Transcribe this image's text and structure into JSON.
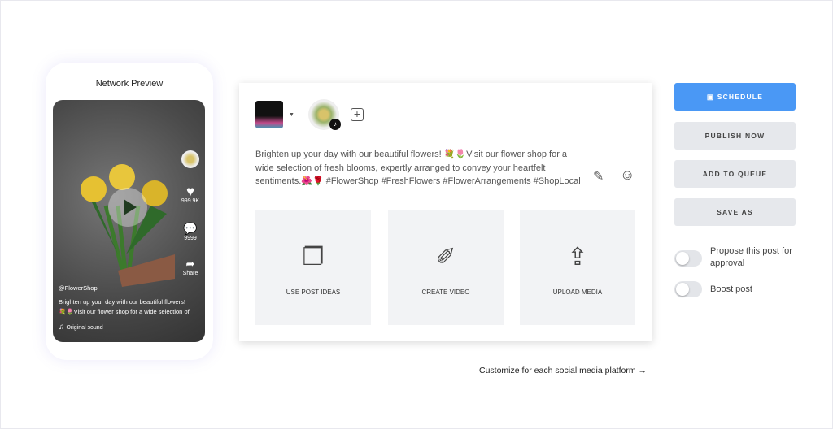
{
  "preview": {
    "title": "Network Preview",
    "likes": "999.9K",
    "comments": "9999",
    "share": "Share",
    "handle": "@FlowerShop",
    "caption_line1": "Brighten up your day with our beautiful flowers!",
    "caption_line2": "💐🌷Visit our flower shop for a wide selection of",
    "sound": "Original sound"
  },
  "composer": {
    "text": "Brighten up your day with our beautiful flowers! 💐🌷Visit our flower shop for a wide selection of fresh blooms, expertly arranged to convey your heartfelt sentiments.🌺🌹 #FlowerShop #FreshFlowers #FlowerArrangements #ShopLocal",
    "tiles": [
      {
        "label": "USE POST IDEAS",
        "icon": "post-ideas-icon"
      },
      {
        "label": "CREATE VIDEO",
        "icon": "create-video-icon"
      },
      {
        "label": "UPLOAD MEDIA",
        "icon": "upload-media-icon"
      }
    ],
    "customize": "Customize for each social media platform →"
  },
  "actions": {
    "schedule": "SCHEDULE",
    "publish": "PUBLISH NOW",
    "queue": "ADD TO QUEUE",
    "save": "SAVE AS",
    "propose": "Propose this post for approval",
    "boost": "Boost post",
    "primary_color": "#4a98f5"
  }
}
